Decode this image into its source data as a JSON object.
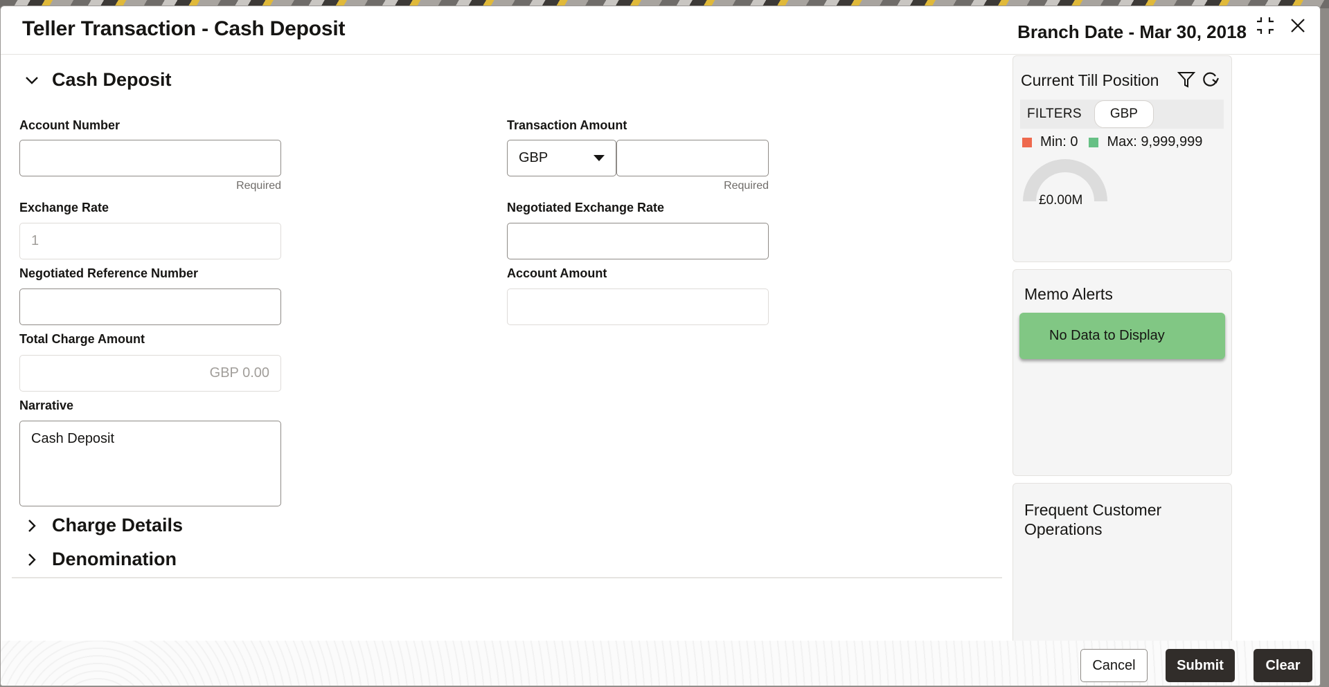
{
  "dialog": {
    "title": "Teller Transaction - Cash Deposit",
    "branch_date": "Branch Date - Mar 30, 2018",
    "icons": {
      "minimize": "minimize-icon",
      "close": "close-icon"
    }
  },
  "sections": {
    "cash_deposit": {
      "title": "Cash Deposit",
      "expanded": true
    },
    "charge_details": {
      "title": "Charge Details",
      "expanded": false
    },
    "denomination": {
      "title": "Denomination",
      "expanded": false
    }
  },
  "form": {
    "account_number": {
      "label": "Account Number",
      "value": "",
      "hint": "Required"
    },
    "transaction_amount": {
      "label": "Transaction Amount",
      "currency": "GBP",
      "value": "",
      "hint": "Required"
    },
    "exchange_rate": {
      "label": "Exchange Rate",
      "value": "1"
    },
    "negotiated_exchange_rate": {
      "label": "Negotiated Exchange Rate",
      "value": ""
    },
    "negotiated_reference_number": {
      "label": "Negotiated Reference Number",
      "value": ""
    },
    "account_amount": {
      "label": "Account Amount",
      "value": ""
    },
    "total_charge_amount": {
      "label": "Total Charge Amount",
      "value": "GBP 0.00"
    },
    "narrative": {
      "label": "Narrative",
      "value": "Cash Deposit"
    }
  },
  "till_position": {
    "title": "Current Till Position",
    "filters_label": "FILTERS",
    "filter_chip": "GBP",
    "legend": [
      {
        "label": "Min: 0",
        "color": "#ee694e"
      },
      {
        "label": "Max: 9,999,999",
        "color": "#67c085"
      }
    ],
    "gauge_value_label": "£0.00M",
    "gauge_value": 0,
    "gauge_min": 0,
    "gauge_max": 9999999,
    "gauge_track_color": "#dcdcdc"
  },
  "memo_alerts": {
    "title": "Memo Alerts",
    "empty_message": "No Data to Display",
    "box_color": "#81c784"
  },
  "frequent_ops": {
    "title": "Frequent Customer Operations"
  },
  "footer": {
    "cancel": "Cancel",
    "submit": "Submit",
    "clear": "Clear"
  }
}
